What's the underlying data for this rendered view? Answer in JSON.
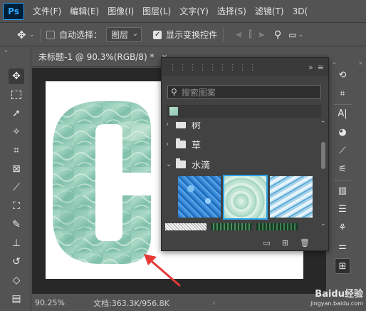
{
  "app": {
    "logo": "Ps"
  },
  "menu": [
    "文件(F)",
    "编辑(E)",
    "图像(I)",
    "图层(L)",
    "文字(Y)",
    "选择(S)",
    "滤镜(T)",
    "3D("
  ],
  "options": {
    "auto_select_label": "自动选择：",
    "auto_select_checked": false,
    "layer_select_value": "图层",
    "show_transform_label": "显示变换控件",
    "show_transform_checked": true
  },
  "document_tab": {
    "title": "未标题-1 @ 90.3%(RGB/8) *",
    "close": "×"
  },
  "canvas": {
    "letter": "C",
    "fill_pattern": "水滴"
  },
  "status": {
    "zoom": "90.25%",
    "doc_size": "文档:363.3K/956.8K",
    "more": "›"
  },
  "pattern_panel": {
    "search_placeholder": "搜索图案",
    "folders": [
      {
        "label": "树",
        "expanded": false
      },
      {
        "label": "草",
        "expanded": false
      },
      {
        "label": "水滴",
        "expanded": true
      }
    ],
    "selected_thumbnail_index": 1,
    "colors": {
      "selection_border": "#2ba3e8"
    }
  },
  "annotation": {
    "color": "#e53935"
  },
  "watermark": {
    "brand": "Baidu经验",
    "url": "jingyan.baidu.com"
  }
}
